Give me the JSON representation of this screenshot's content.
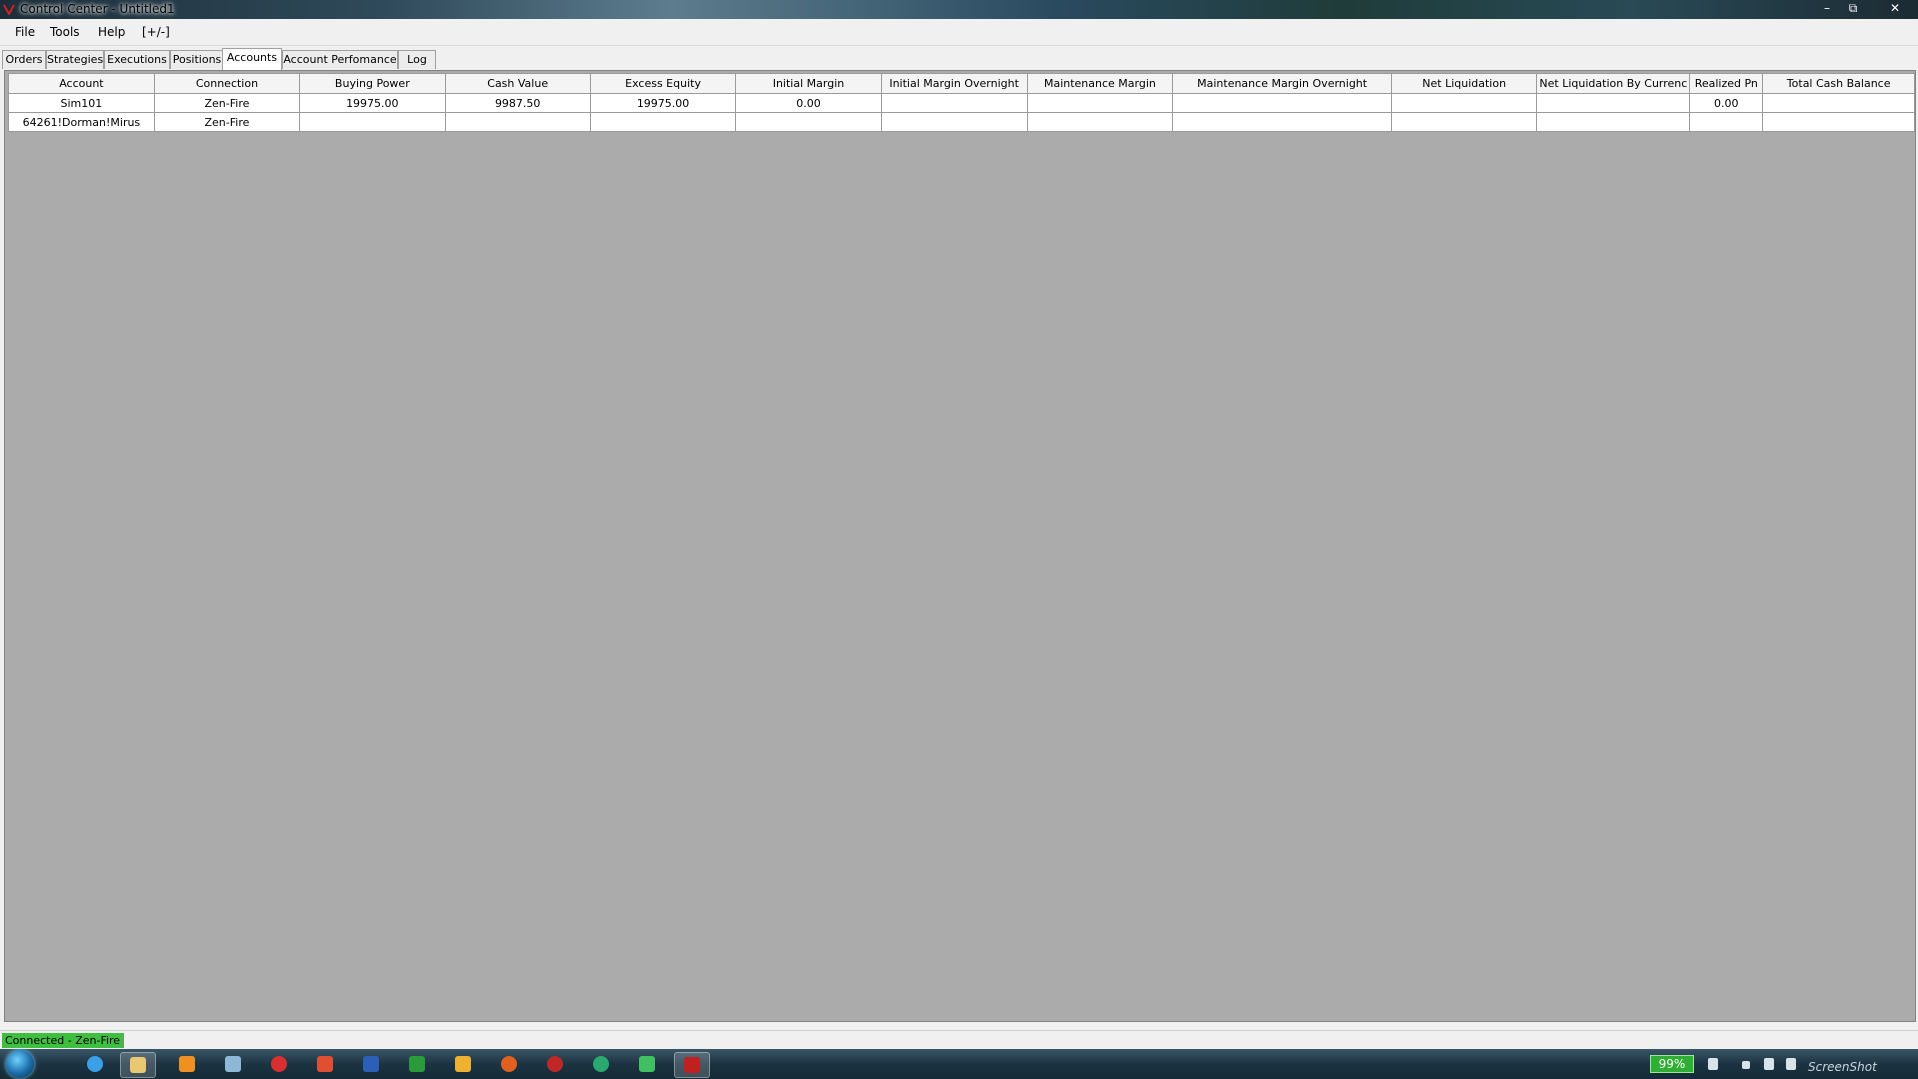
{
  "window": {
    "title": "Control Center - Untitled1",
    "controls": {
      "minimize": "–",
      "restore": "⧉",
      "close": "✕"
    }
  },
  "menu": {
    "items": [
      "File",
      "Tools",
      "Help",
      "[+/-]"
    ]
  },
  "tabs": [
    "Orders",
    "Strategies",
    "Executions",
    "Positions",
    "Accounts",
    "Account Perfomance",
    "Log"
  ],
  "active_tab": "Accounts",
  "accounts_table": {
    "columns": [
      "Account",
      "Connection",
      "Buying Power",
      "Cash Value",
      "Excess Equity",
      "Initial Margin",
      "Initial Margin Overnight",
      "Maintenance Margin",
      "Maintenance Margin Overnight",
      "Net Liquidation",
      "Net Liquidation By Currenc",
      "Realized Pn",
      "Total Cash Balance"
    ],
    "rows": [
      [
        "Sim101",
        "Zen-Fire",
        "19975.00",
        "9987.50",
        "19975.00",
        "0.00",
        "",
        "",
        "",
        "",
        "",
        "0.00",
        ""
      ],
      [
        "64261!Dorman!Mirus",
        "Zen-Fire",
        "",
        "",
        "",
        "",
        "",
        "",
        "",
        "",
        "",
        "",
        ""
      ]
    ]
  },
  "status": {
    "connection": "Connected - Zen-Fire"
  },
  "taskbar": {
    "battery": "99%",
    "watermark": "ScreenShot"
  },
  "colors": {
    "status_ok": "#3fbf3f",
    "grid_background": "#ababab",
    "battery": "#2fae34"
  }
}
